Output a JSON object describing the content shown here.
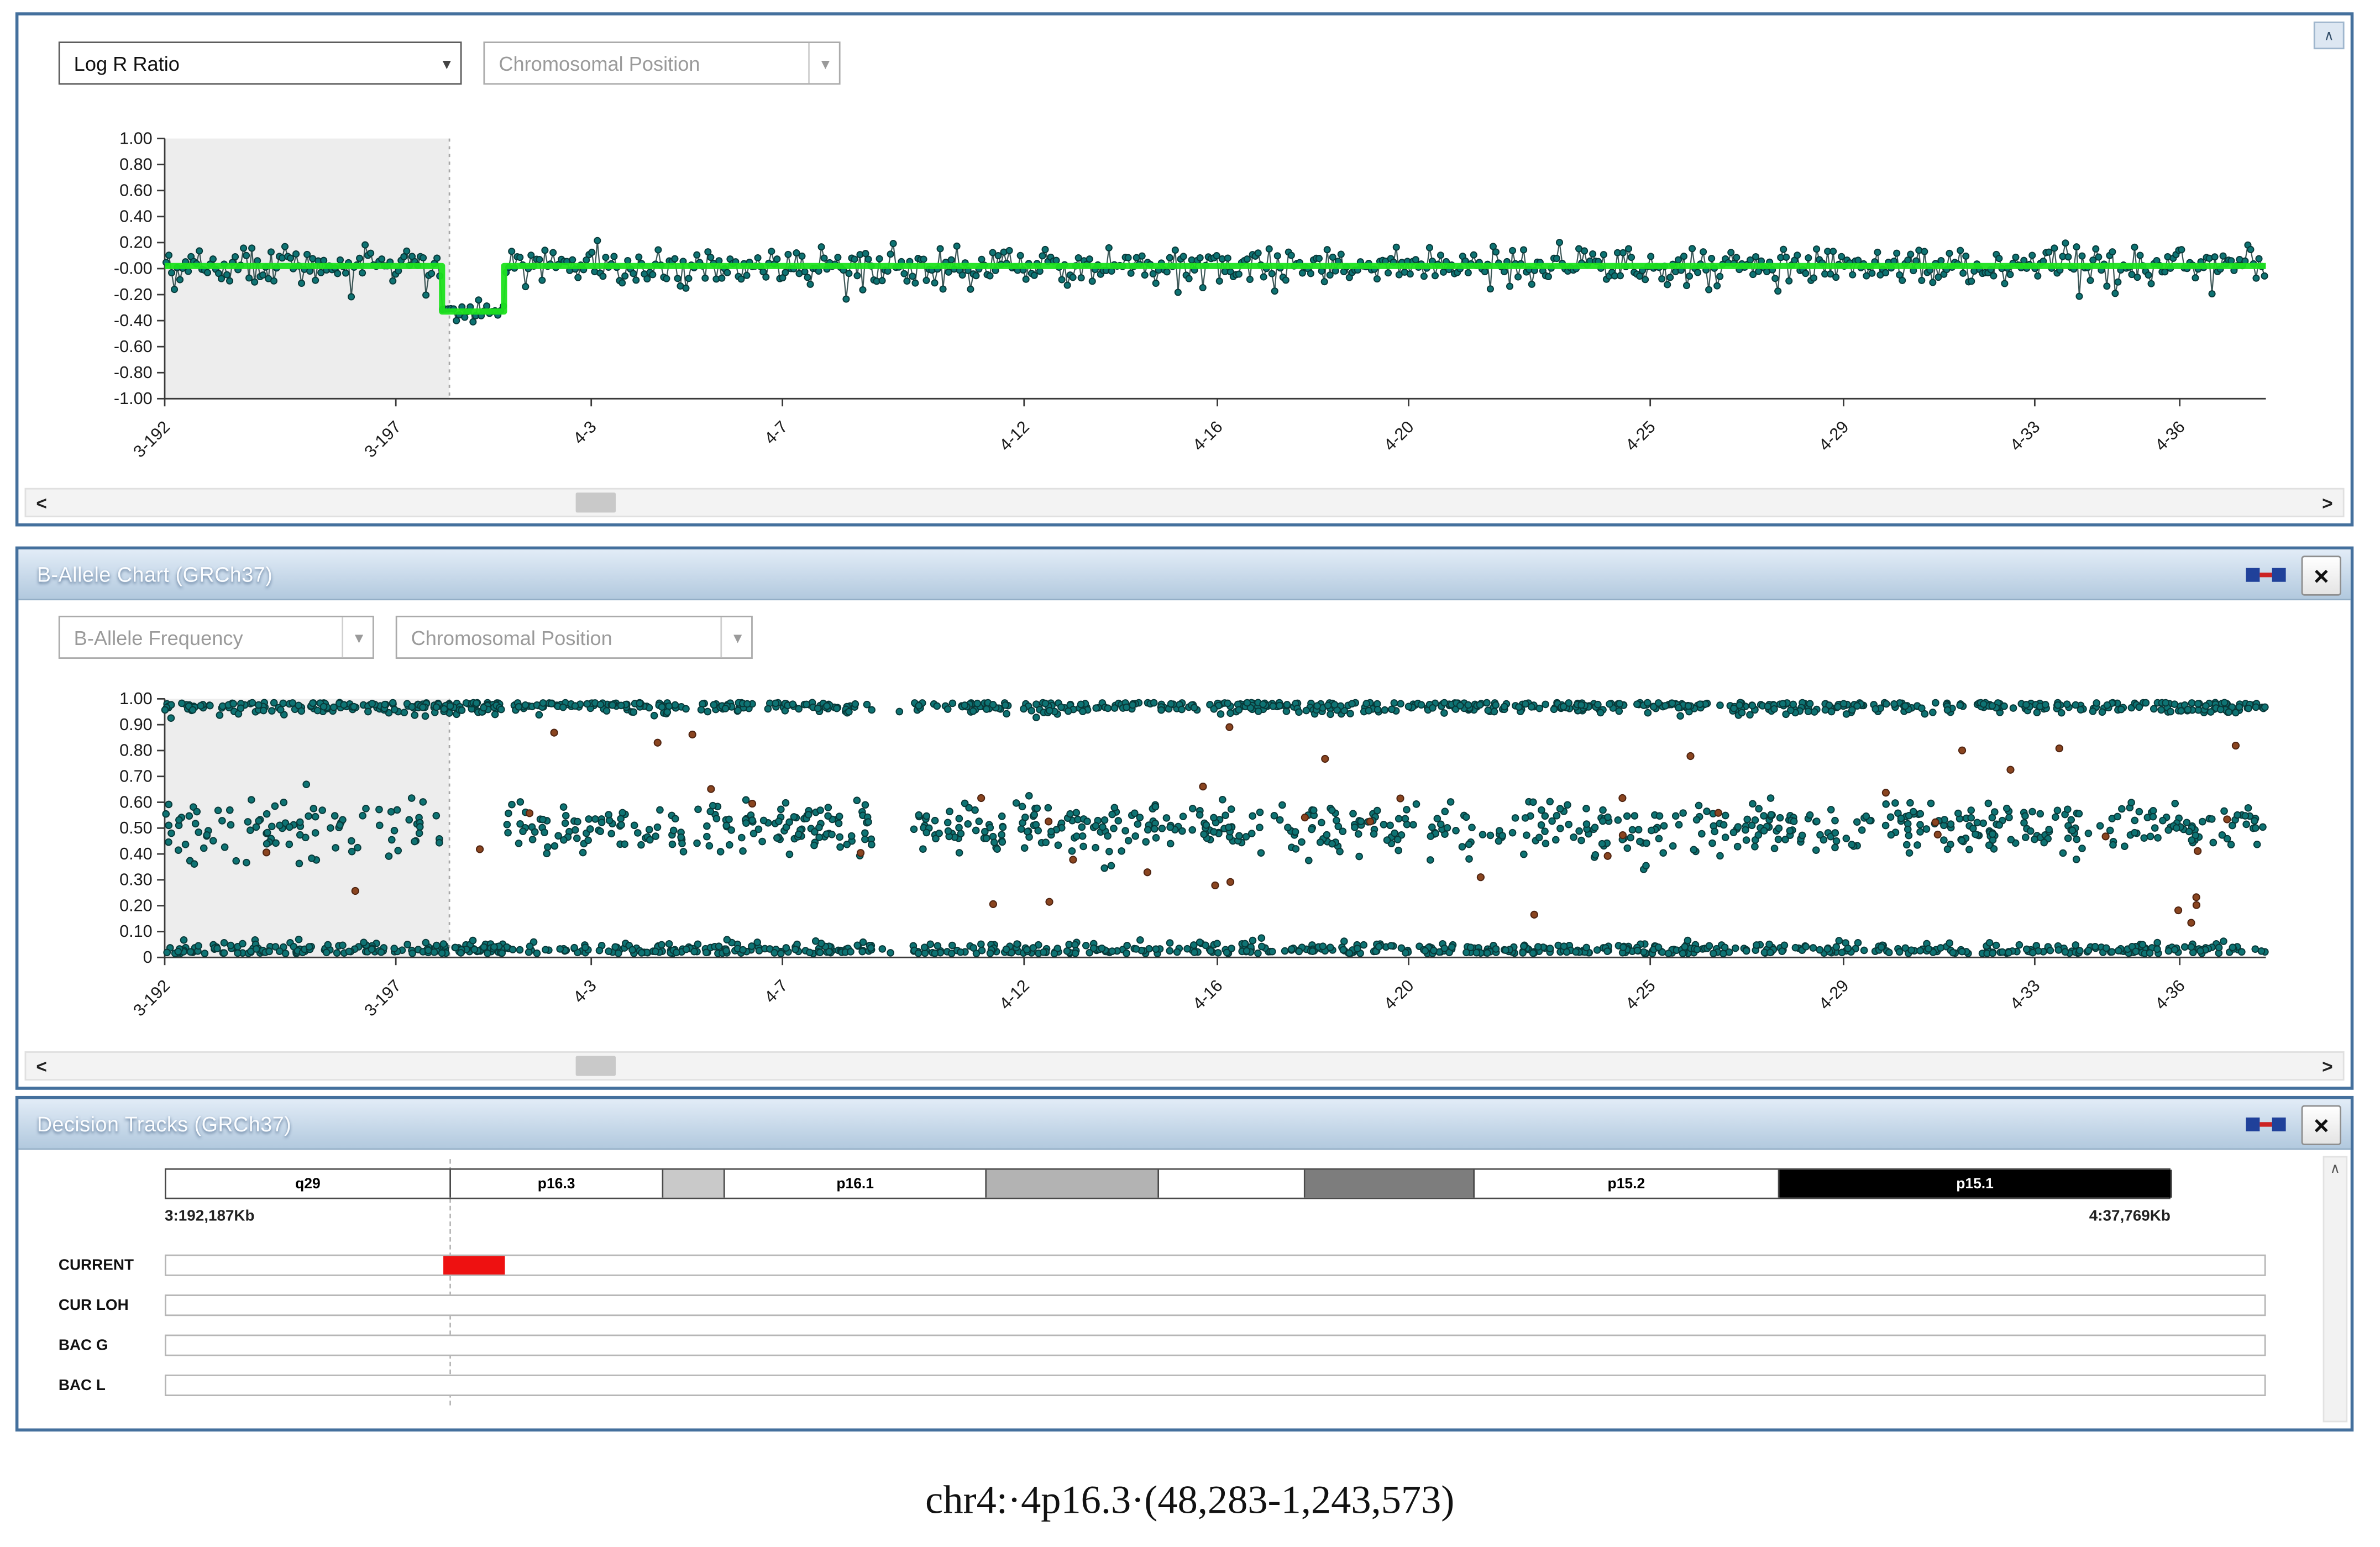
{
  "icons": {
    "chevron_down": "▾",
    "scroll_left": "<",
    "scroll_right": ">",
    "scroll_up": "∧",
    "close": "×"
  },
  "panel1": {
    "y_dropdown": "Log R Ratio",
    "x_dropdown": "Chromosomal Position",
    "y_ticks": [
      "1.00",
      "0.80",
      "0.60",
      "0.40",
      "0.20",
      "-0.00",
      "-0.20",
      "-0.40",
      "-0.60",
      "-0.80",
      "-1.00"
    ],
    "y_vals": [
      1,
      0.8,
      0.6,
      0.4,
      0.2,
      0,
      -0.2,
      -0.4,
      -0.6,
      -0.8,
      -1
    ]
  },
  "panel2": {
    "title": "B-Allele Chart (GRCh37)",
    "y_dropdown": "B-Allele Frequency",
    "x_dropdown": "Chromosomal Position",
    "y_ticks": [
      "1.00",
      "0.90",
      "0.80",
      "0.70",
      "0.60",
      "0.50",
      "0.40",
      "0.30",
      "0.20",
      "0.10",
      "0"
    ],
    "y_vals": [
      1,
      0.9,
      0.8,
      0.7,
      0.6,
      0.5,
      0.4,
      0.3,
      0.2,
      0.1,
      0
    ]
  },
  "x_ticks": [
    {
      "label": "3-192",
      "f": 0
    },
    {
      "label": "3-197",
      "f": 0.11
    },
    {
      "label": "4-3",
      "f": 0.203
    },
    {
      "label": "4-7",
      "f": 0.294
    },
    {
      "label": "4-12",
      "f": 0.409
    },
    {
      "label": "4-16",
      "f": 0.501
    },
    {
      "label": "4-20",
      "f": 0.592
    },
    {
      "label": "4-25",
      "f": 0.707
    },
    {
      "label": "4-29",
      "f": 0.799
    },
    {
      "label": "4-33",
      "f": 0.89
    },
    {
      "label": "4-36",
      "f": 0.959
    }
  ],
  "panel3": {
    "title": "Decision Tracks (GRCh37)",
    "pos_left": "3:192,187Kb",
    "pos_right": "4:37,769Kb",
    "tracks": [
      "CURRENT",
      "CUR LOH",
      "BAC G",
      "BAC L"
    ],
    "marker": {
      "f0": 0.132,
      "f1": 0.1615,
      "color": "#ee1111"
    },
    "ideogram": [
      {
        "label": "q29",
        "f0": 0,
        "f1": 0.1355,
        "fill": "#ffffff",
        "text": "#000000"
      },
      {
        "label": "p16.3",
        "f0": 0.1355,
        "f1": 0.2366,
        "fill": "#ffffff",
        "text": "#000000"
      },
      {
        "label": "",
        "f0": 0.2366,
        "f1": 0.266,
        "fill": "#c9c9c9",
        "text": "#000000"
      },
      {
        "label": "p16.1",
        "f0": 0.266,
        "f1": 0.3905,
        "fill": "#ffffff",
        "text": "#000000"
      },
      {
        "label": "",
        "f0": 0.3905,
        "f1": 0.4725,
        "fill": "#b3b3b3",
        "text": "#000000"
      },
      {
        "label": "",
        "f0": 0.4725,
        "f1": 0.542,
        "fill": "#ffffff",
        "text": "#000000"
      },
      {
        "label": "",
        "f0": 0.542,
        "f1": 0.6227,
        "fill": "#7d7d7d",
        "text": "#000000"
      },
      {
        "label": "p15.2",
        "f0": 0.6227,
        "f1": 0.7678,
        "fill": "#ffffff",
        "text": "#000000"
      },
      {
        "label": "p15.1",
        "f0": 0.7678,
        "f1": 0.9545,
        "fill": "#000000",
        "text": "#ffffff"
      }
    ]
  },
  "caption": "chr4:·4p16.3·(48,283-1,243,573)",
  "chart_data": [
    {
      "type": "scatter",
      "title": "Log R Ratio vs Chromosomal Position",
      "ylabel": "Log R Ratio",
      "ylim": [
        -1,
        1
      ],
      "x_tick_labels": [
        "3-192",
        "3-197",
        "4-3",
        "4-7",
        "4-12",
        "4-16",
        "4-20",
        "4-25",
        "4-29",
        "4-33",
        "4-36"
      ],
      "chr_boundary_f": 0.1355,
      "point_color": "#0e7373",
      "series_model": {
        "n_points": 760,
        "baseline_mean": 0.02,
        "baseline_sd": 0.07,
        "deletion_region": {
          "f0": 0.132,
          "f1": 0.1615,
          "mean": -0.33,
          "sd": 0.045
        },
        "segmentation_line": {
          "normal_y": 0.02,
          "deletion_y": -0.33,
          "color": "#1de21d",
          "width": 4
        }
      }
    },
    {
      "type": "scatter",
      "title": "B-Allele Frequency vs Chromosomal Position",
      "ylabel": "B-Allele Frequency",
      "ylim": [
        0,
        1
      ],
      "chr_boundary_f": 0.1355,
      "bands": {
        "top_mean": 0.985,
        "mid_mean": 0.5,
        "bottom_mean": 0.015
      },
      "deletion_region": {
        "f0": 0.132,
        "f1": 0.1615
      },
      "gap_region": [
        0.337,
        0.356
      ],
      "n_points": 2600,
      "n_outliers": 45,
      "point_color": "#0e7373",
      "outlier_color": "#8a4520"
    }
  ]
}
